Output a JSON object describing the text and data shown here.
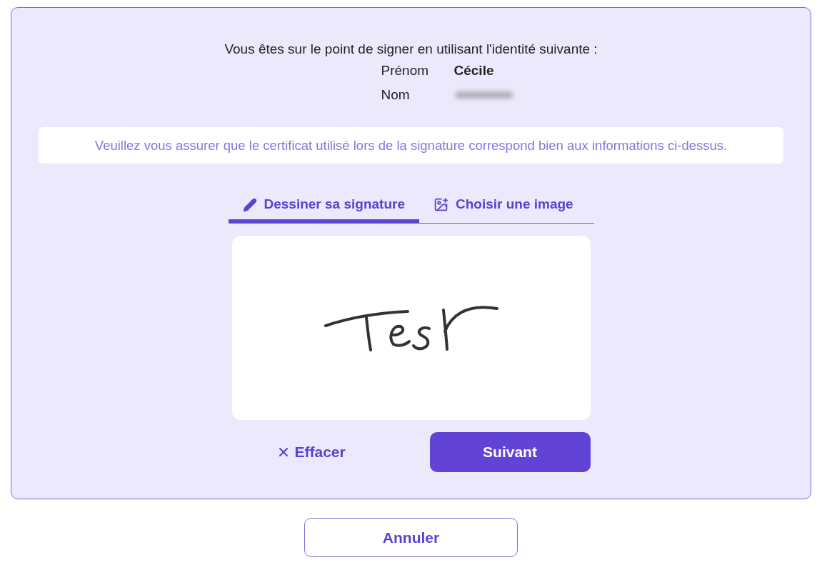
{
  "intro": "Vous êtes sur le point de signer en utilisant l'identité suivante :",
  "identity": [
    {
      "label": "Prénom",
      "value": "Cécile",
      "redacted": false
    },
    {
      "label": "Nom",
      "redacted": true
    }
  ],
  "notice": "Veuillez vous assurer que le certificat utilisé lors de la signature correspond bien aux informations ci-dessus.",
  "tabs": [
    {
      "label": "Dessiner sa signature",
      "kind": "draw",
      "selected": true
    },
    {
      "label": "Choisir une image",
      "kind": "image",
      "selected": false
    }
  ],
  "clear_button": "Effacer",
  "next_button": "Suivant",
  "cancel_button": "Annuler"
}
